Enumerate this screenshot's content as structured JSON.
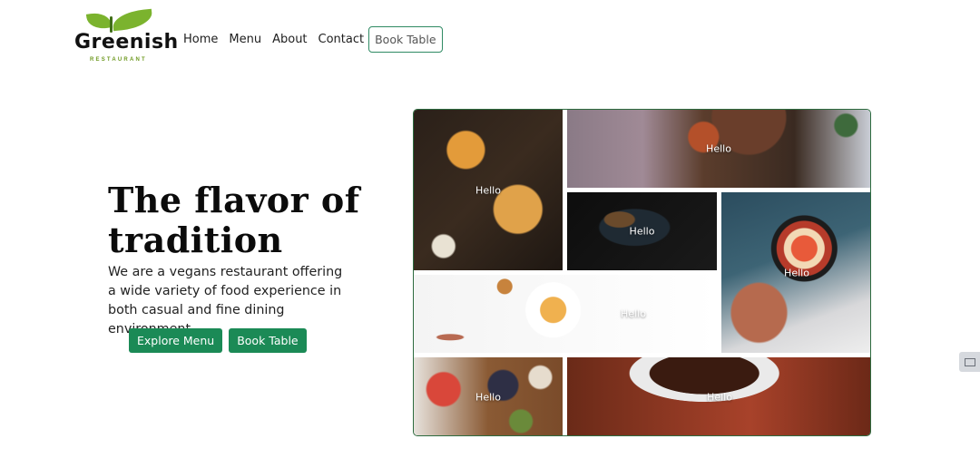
{
  "brand": {
    "name": "Greenish",
    "tagline": "RESTAURANT",
    "accent": "#1b8a56",
    "leaf_color": "#7bb32e"
  },
  "nav": {
    "items": [
      {
        "label": "Home"
      },
      {
        "label": "Menu"
      },
      {
        "label": "About"
      },
      {
        "label": "Contact"
      }
    ],
    "book_label": "Book Table"
  },
  "hero": {
    "title": "The flavor of tradition",
    "description": "We are a vegans restaurant offering a wide variety of food experience in both casual and fine dining environment.",
    "buttons": {
      "explore": "Explore Menu",
      "book": "Book Table"
    }
  },
  "gallery": {
    "tiles": [
      {
        "label": "Hello"
      },
      {
        "label": "Hello"
      },
      {
        "label": "Hello"
      },
      {
        "label": "Hello"
      },
      {
        "label": "Hello"
      },
      {
        "label": "Hello"
      },
      {
        "label": "Hello"
      }
    ]
  },
  "side_widget": {
    "icon": "mail-icon"
  }
}
